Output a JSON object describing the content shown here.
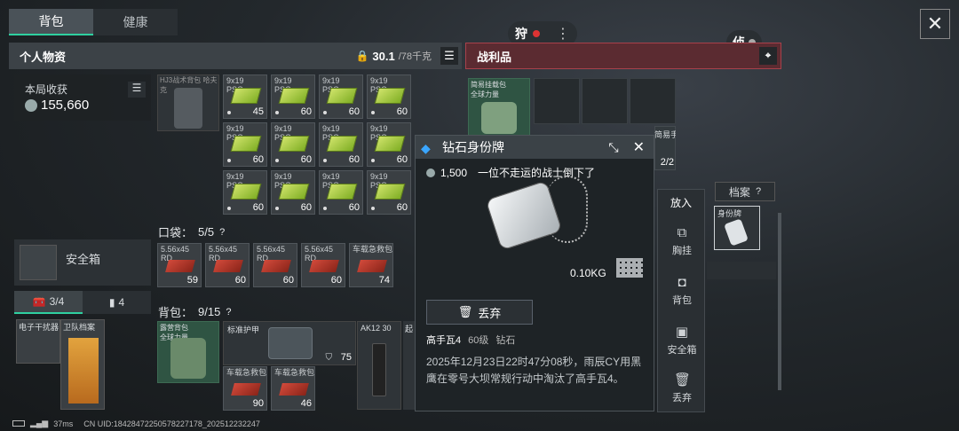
{
  "tabs": {
    "backpack": "背包",
    "health": "健康"
  },
  "top_badges": {
    "left": "狩",
    "right": "侦"
  },
  "personal": {
    "title": "个人物资",
    "weight": "30.1",
    "weight_max": "/78千克"
  },
  "loot": {
    "title": "战利品"
  },
  "harvest": {
    "label": "本局收获",
    "value": "155,660"
  },
  "equip_label": "HJ3战术背包 哈夫克",
  "safe_box": "安全箱",
  "bottom_tabs": {
    "a": "3/4",
    "b": "4"
  },
  "cards": {
    "a": "电子干扰器",
    "b": "卫队档案",
    "c": "露营背包 全球力量",
    "d": "标准护甲",
    "e": "AK12 30",
    "f": "起"
  },
  "ammo_label": "9x19\nPSO",
  "ammo_counts": [
    "45",
    "60",
    "60",
    "60",
    "60",
    "60",
    "60",
    "60",
    "60",
    "60",
    "60",
    "60"
  ],
  "pocket": {
    "title": "口袋：",
    "value": "5/5"
  },
  "rd_items": [
    {
      "l": "5.56x45\nRD",
      "c": "59"
    },
    {
      "l": "5.56x45\nRD",
      "c": "60"
    },
    {
      "l": "5.56x45\nRD",
      "c": "60"
    },
    {
      "l": "5.56x45\nRD",
      "c": "60"
    },
    {
      "l": "车载急救包",
      "c": "74"
    }
  ],
  "bag": {
    "title": "背包：",
    "value": "9/15"
  },
  "bag_items": {
    "armor_val": "75",
    "kit1": "车载急救包",
    "kit1_c": "90",
    "kit2": "车载急救包",
    "kit2_c": "46"
  },
  "loot_items": {
    "rig": "简易挂载包 全球力量",
    "kit": "简易手术包",
    "kit_c": "2/2"
  },
  "archive": {
    "label": "档案",
    "tag": "身份牌"
  },
  "popup": {
    "title": "钻石身份牌",
    "price": "1,500",
    "desc": "一位不走运的战士倒下了",
    "weight": "0.10KG",
    "discard": "丢弃",
    "owner": "高手瓦4",
    "level": "60级",
    "rank": "钻石",
    "story": "2025年12月23日22时47分08秒，雨辰CY用黑鹰在零号大坝常规行动中淘汰了高手瓦4。"
  },
  "sidebar": {
    "put": "放入",
    "chest": "胸挂",
    "bag": "背包",
    "safe": "安全箱",
    "drop": "丢弃"
  },
  "status": {
    "ping": "37ms",
    "uid": "CN UID:18428472250578227178_202512232247"
  },
  "colors": {
    "accent": "#2fd0a0",
    "loot_red": "#a8414b"
  }
}
